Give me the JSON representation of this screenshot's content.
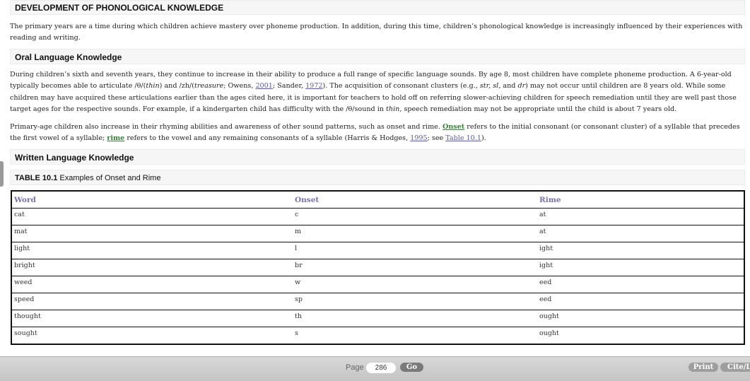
{
  "main_heading": "DEVELOPMENT OF PHONOLOGICAL KNOWLEDGE",
  "intro_para": "The primary years are a time during which children achieve mastery over phoneme production. In addition, during this time, children’s phonological knowledge is increasingly influenced by their experiences with reading and writing.",
  "oral_heading": "Oral Language Knowledge",
  "oral_para1": {
    "t1": "During children’s sixth and seventh years, they continue to increase in their ability to produce a full range of specific language sounds. By age 8, most children have complete phoneme production. A 6-year-old typically becomes able to articulate /θ/(",
    "thin": "thin",
    "t2": ") and /zh/(",
    "treasure": "treasure",
    "t3": "; Owens, ",
    "ref1": "2001",
    "t4": "; Sander, ",
    "ref2": "1972",
    "t5": "). The acquisition of consonant clusters (e.g., ",
    "ex": "str, sl,",
    "t6": " and ",
    "ex2": "dr",
    "t7": ") may not occur until children are 8 years old. While some children may have acquired these articulations earlier than the ages cited here, it is important for teachers to hold off on referring slower-achieving children for speech remediation until they are well past those target ages for the respective sounds. For example, if a kindergarten child has difficulty with the /θ/sound in ",
    "thin2": "thin,",
    "t8": " speech remediation may not be appropriate until the child is about 7 years old."
  },
  "oral_para2": {
    "t1": "Primary-age children also increase in their rhyming abilities and awareness of other sound patterns, such as onset and rime. ",
    "onset": "Onset",
    "t2": " refers to the initial consonant (or consonant cluster) of a syllable that precedes the first vowel of a syllable; ",
    "rime": "rime",
    "t3": " refers to the vowel and any remaining consonants of a syllable (Harris & Hodges, ",
    "ref": "1995",
    "t4": "; see ",
    "table_link": "Table 10.1",
    "t5": ")."
  },
  "written_heading": "Written Language Knowledge",
  "table": {
    "caption_num": "TABLE 10.1",
    "caption_text": " Examples of Onset and Rime",
    "headers": [
      "Word",
      "Onset",
      "Rime"
    ],
    "rows": [
      [
        "cat",
        "c",
        "at"
      ],
      [
        "mat",
        "m",
        "at"
      ],
      [
        "light",
        "l",
        "ight"
      ],
      [
        "bright",
        "br",
        "ight"
      ],
      [
        "weed",
        "w",
        "eed"
      ],
      [
        "speed",
        "sp",
        "eed"
      ],
      [
        "thought",
        "th",
        "ought"
      ],
      [
        "sought",
        "s",
        "ought"
      ]
    ]
  },
  "footer": {
    "page_label": "Page",
    "page_value": "286",
    "go_label": "Go",
    "print_label": "Print",
    "cite_label": "Cite/Link"
  }
}
